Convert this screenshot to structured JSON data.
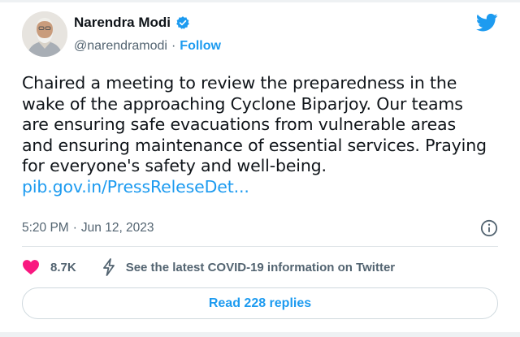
{
  "author": {
    "name": "Narendra Modi",
    "handle": "@narendramodi",
    "separator": "·",
    "follow_label": "Follow",
    "verified_icon": "verified-badge-icon"
  },
  "tweet": {
    "text": "Chaired a meeting to review the preparedness in the\nwake of the approaching Cyclone Biparjoy. Our teams\nare ensuring safe evacuations from vulnerable areas\nand ensuring maintenance of essential services. Praying\nfor everyone's safety and well-being.",
    "link": "pib.gov.in/PressReleseDet..."
  },
  "meta": {
    "time": "5:20 PM",
    "separator": "·",
    "date": "Jun 12, 2023"
  },
  "actions": {
    "like_count": "8.7K",
    "covid_notice": "See the latest COVID-19 information on Twitter"
  },
  "replies_button": "Read 228 replies",
  "colors": {
    "accent": "#1d9bf0",
    "like": "#f91880",
    "text": "#0f1419",
    "muted": "#536471"
  }
}
